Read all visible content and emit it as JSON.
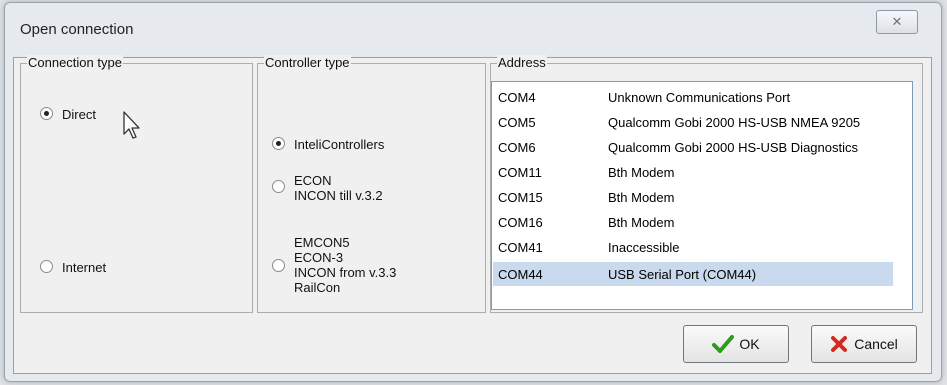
{
  "window": {
    "title": "Open connection",
    "close_glyph": "✕"
  },
  "connection_type": {
    "label": "Connection type",
    "options": [
      {
        "label": "Direct",
        "selected": true
      },
      {
        "label": "Internet",
        "selected": false
      }
    ]
  },
  "controller_type": {
    "label": "Controller type",
    "options": [
      {
        "lines": [
          "InteliControllers"
        ],
        "selected": true
      },
      {
        "lines": [
          "ECON",
          "INCON till v.3.2"
        ],
        "selected": false
      },
      {
        "lines": [
          "EMCON5",
          "ECON-3",
          "INCON from v.3.3",
          "RailCon"
        ],
        "selected": false
      }
    ]
  },
  "address": {
    "label": "Address",
    "rows": [
      {
        "port": "COM4",
        "description": "Unknown Communications Port",
        "selected": false
      },
      {
        "port": "COM5",
        "description": "Qualcomm Gobi 2000 HS-USB NMEA 9205",
        "selected": false
      },
      {
        "port": "COM6",
        "description": "Qualcomm Gobi 2000 HS-USB Diagnostics",
        "selected": false
      },
      {
        "port": "COM11",
        "description": "Bth Modem",
        "selected": false
      },
      {
        "port": "COM15",
        "description": "Bth Modem",
        "selected": false
      },
      {
        "port": "COM16",
        "description": "Bth Modem",
        "selected": false
      },
      {
        "port": "COM41",
        "description": "Inaccessible",
        "selected": false
      },
      {
        "port": "COM44",
        "description": "USB Serial Port (COM44)",
        "selected": true
      }
    ]
  },
  "buttons": {
    "ok": {
      "label": "OK",
      "icon": "check-icon",
      "color": "#2e9a1e"
    },
    "cancel": {
      "label": "Cancel",
      "icon": "x-icon",
      "color": "#d4291f"
    }
  },
  "colors": {
    "selection": "#c9d9ee",
    "list_border": "#7f9db9"
  }
}
